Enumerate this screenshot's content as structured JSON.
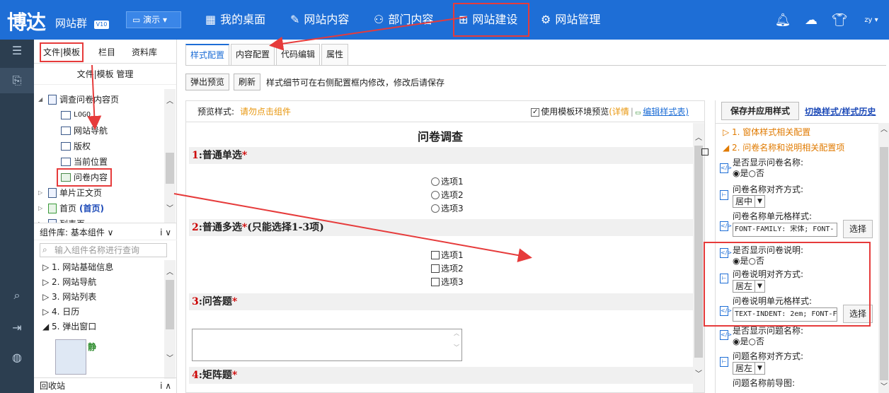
{
  "topbar": {
    "logo": "博达",
    "product": "网站群",
    "version": "V10",
    "demo_label": "演示",
    "nav": [
      {
        "label": "我的桌面",
        "icon": "grid-icon"
      },
      {
        "label": "网站内容",
        "icon": "edit-icon"
      },
      {
        "label": "部门内容",
        "icon": "org-icon"
      },
      {
        "label": "网站建设",
        "icon": "build-icon"
      },
      {
        "label": "网站管理",
        "icon": "manage-icon"
      }
    ],
    "user": "zy"
  },
  "sidebar": {
    "tabs": [
      "文件|模板",
      "栏目",
      "资料库"
    ],
    "title": "文件|模板 管理",
    "tree": [
      {
        "label": "调查问卷内容页"
      },
      {
        "label": "LOGO"
      },
      {
        "label": "网站导航"
      },
      {
        "label": "版权"
      },
      {
        "label": "当前位置"
      },
      {
        "label": "问卷内容"
      },
      {
        "label": "单片正文页"
      },
      {
        "label": "首页",
        "extra": "(首页)"
      },
      {
        "label": "列表页"
      }
    ],
    "component_lib": "组件库: 基本组件",
    "search_placeholder": "输入组件名称进行查询",
    "components": [
      "1. 网站基础信息",
      "2. 网站导航",
      "3. 网站列表",
      "4. 日历",
      "5. 弹出窗口"
    ],
    "thumb_label": "静",
    "recycle": "回收站"
  },
  "main": {
    "tabs": [
      "样式配置",
      "内容配置",
      "代码编辑",
      "属性"
    ],
    "toolbar": {
      "preview": "弹出预览",
      "refresh": "刷新",
      "tip": "样式细节可在右侧配置框内修改，修改后请保存"
    },
    "preview": {
      "label": "预览样式:",
      "hint": "请勿点击组件",
      "use_tpl": "使用模板环境预览",
      "detail": "(详情",
      "edit_style": "编辑样式表)"
    },
    "survey": {
      "title": "问卷调查",
      "q1": {
        "num": "1",
        "text": ":普通单选",
        "star": "*",
        "options": [
          "选项1",
          "选项2",
          "选项3"
        ]
      },
      "q2": {
        "num": "2",
        "text": ":普通多选",
        "star": "*",
        "note": "(只能选择1-3项)",
        "options": [
          "选项1",
          "选项2",
          "选项3"
        ]
      },
      "q3": {
        "num": "3",
        "text": ":问答题",
        "star": "*"
      },
      "q4": {
        "num": "4",
        "text": ":矩阵题",
        "star": "*"
      }
    }
  },
  "right": {
    "save": "保存并应用样式",
    "switch": "切换样式/样式历史",
    "sections": [
      "1. 窗体样式相关配置",
      "2. 问卷名称和说明相关配置项"
    ],
    "fields": {
      "show_name": "是否显示问卷名称:",
      "yes": "是",
      "no": "否",
      "name_align": "问卷名称对齐方式:",
      "name_align_val": "居中",
      "name_cell": "问卷名称单元格样式:",
      "name_cell_val": "FONT-FAMILY: 宋体; FONT-",
      "pick": "选择",
      "show_desc": "是否显示问卷说明:",
      "desc_align": "问卷说明对齐方式:",
      "desc_align_val": "居左",
      "desc_cell": "问卷说明单元格样式:",
      "desc_cell_val": "TEXT-INDENT: 2em; FONT-F",
      "show_q": "是否显示问题名称:",
      "q_align": "问题名称对齐方式:",
      "q_align_val": "居左",
      "q_prefix": "问题名称前导图:"
    }
  },
  "colors": {
    "brand": "#1e6ed6",
    "highlight": "#e63b3b",
    "accent_orange": "#e8960c"
  }
}
